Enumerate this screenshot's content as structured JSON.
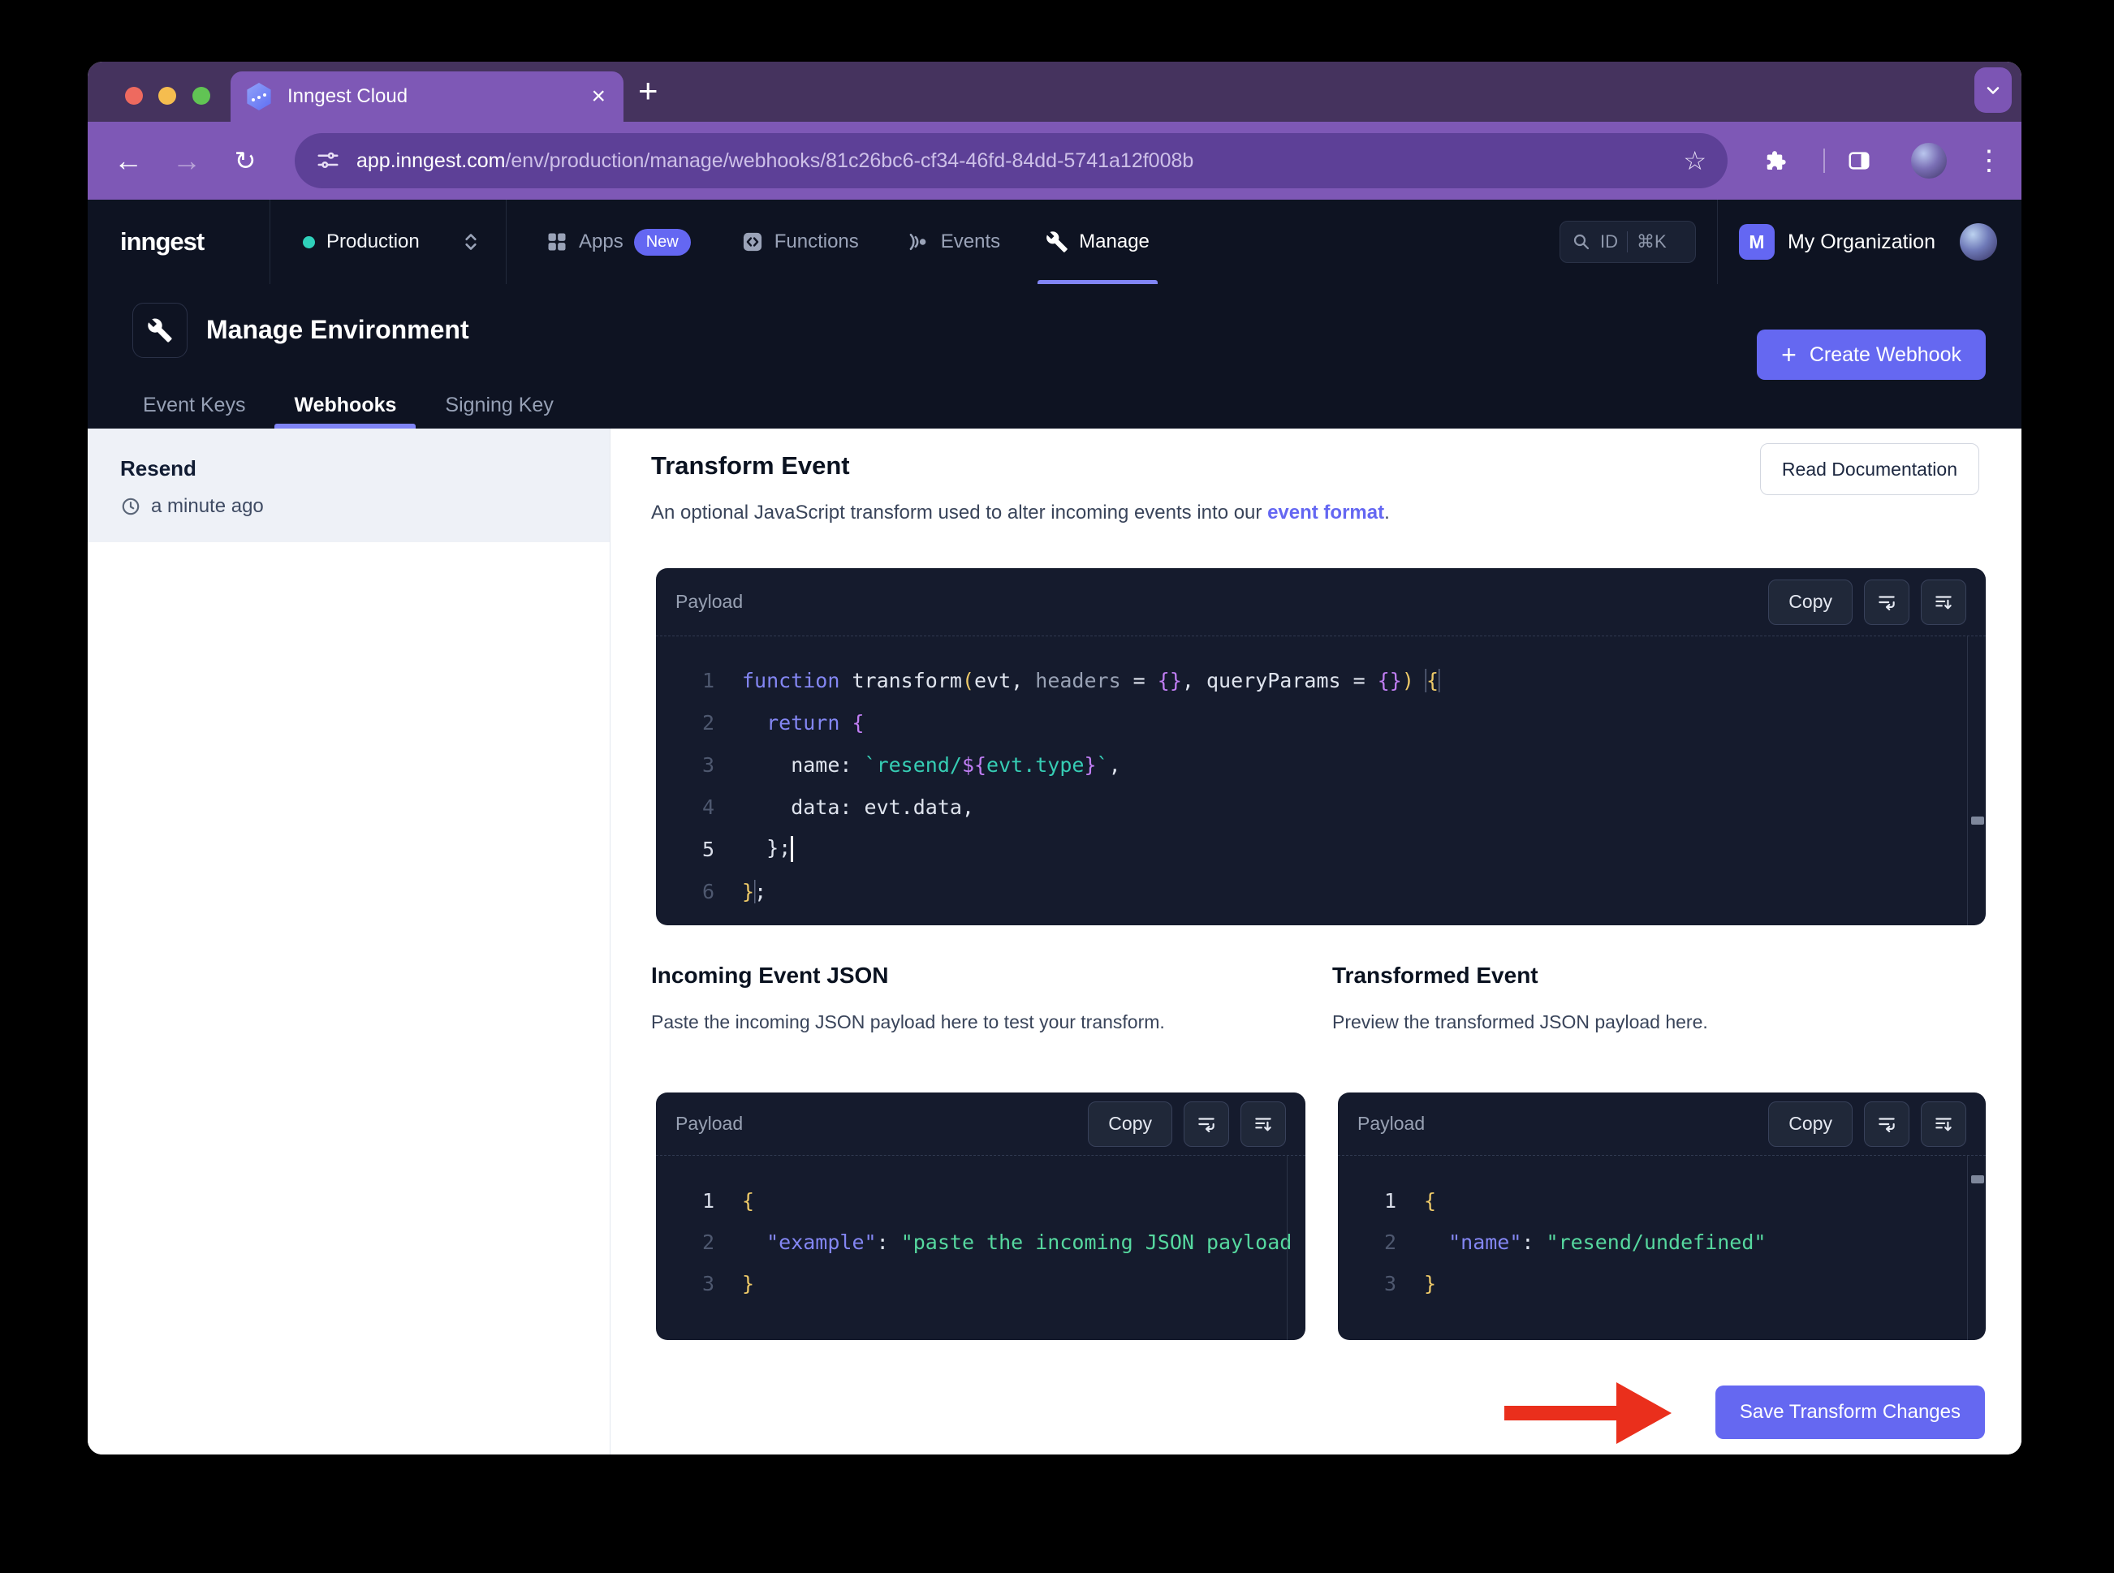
{
  "browser": {
    "tab_title": "Inngest Cloud",
    "url_host": "app.inngest.com",
    "url_path": "/env/production/manage/webhooks/81c26bc6-cf34-46fd-84dd-5741a12f008b",
    "close_glyph": "×",
    "new_tab_glyph": "+",
    "back_glyph": "←",
    "forward_glyph": "→",
    "reload_glyph": "↻",
    "star_glyph": "☆",
    "kebab_glyph": "⋮"
  },
  "nav": {
    "logo": "inngest",
    "env": "Production",
    "apps": "Apps",
    "apps_badge": "New",
    "functions": "Functions",
    "events": "Events",
    "manage": "Manage",
    "search_id": "ID",
    "search_kbd": "⌘K",
    "org_initial": "M",
    "org_name": "My Organization"
  },
  "header": {
    "title": "Manage Environment",
    "create_plus": "+",
    "create": "Create Webhook",
    "tabs": [
      {
        "label": "Event Keys",
        "active": false
      },
      {
        "label": "Webhooks",
        "active": true
      },
      {
        "label": "Signing Key",
        "active": false
      }
    ]
  },
  "sidebar": {
    "name": "Resend",
    "time": "a minute ago"
  },
  "main": {
    "title": "Transform Event",
    "desc_prefix": "An optional JavaScript transform used to alter incoming events into our ",
    "desc_link": "event format",
    "desc_suffix": ".",
    "read_docs": "Read Documentation",
    "payload_label": "Payload",
    "copy_label": "Copy",
    "incoming_title": "Incoming Event JSON",
    "incoming_desc": "Paste the incoming JSON payload here to test your transform.",
    "transformed_title": "Transformed Event",
    "transformed_desc": "Preview the transformed JSON payload here.",
    "save": "Save Transform Changes",
    "transform_lines": [
      {
        "n": "1",
        "active": false,
        "tokens": [
          {
            "c": "k",
            "t": "function"
          },
          {
            "c": "w",
            "t": " transform"
          },
          {
            "c": "y",
            "t": "("
          },
          {
            "c": "w",
            "t": "evt"
          },
          {
            "c": "w",
            "t": ", "
          },
          {
            "c": "g",
            "t": "headers"
          },
          {
            "c": "w",
            "t": " = "
          },
          {
            "c": "p",
            "t": "{}"
          },
          {
            "c": "w",
            "t": ", "
          },
          {
            "c": "w",
            "t": "queryParams"
          },
          {
            "c": "w",
            "t": " = "
          },
          {
            "c": "p",
            "t": "{}"
          },
          {
            "c": "y",
            "t": ")"
          },
          {
            "c": "w",
            "t": " "
          },
          {
            "c": "y",
            "t": "{",
            "box": true
          }
        ]
      },
      {
        "n": "2",
        "active": false,
        "tokens": [
          {
            "c": "k",
            "t": "  return"
          },
          {
            "c": "w",
            "t": " "
          },
          {
            "c": "p",
            "t": "{"
          }
        ]
      },
      {
        "n": "3",
        "active": false,
        "tokens": [
          {
            "c": "w",
            "t": "    name: "
          },
          {
            "c": "t",
            "t": "`resend/"
          },
          {
            "c": "p",
            "t": "${"
          },
          {
            "c": "t",
            "t": "evt.type"
          },
          {
            "c": "p",
            "t": "}"
          },
          {
            "c": "t",
            "t": "`"
          },
          {
            "c": "w",
            "t": ","
          }
        ]
      },
      {
        "n": "4",
        "active": false,
        "tokens": [
          {
            "c": "w",
            "t": "    data: evt.data,"
          }
        ]
      },
      {
        "n": "5",
        "active": true,
        "tokens": [
          {
            "c": "w",
            "t": "  };"
          },
          {
            "caret": true
          }
        ]
      },
      {
        "n": "6",
        "active": false,
        "tokens": [
          {
            "c": "y",
            "t": "}",
            "box": true
          },
          {
            "c": "w",
            "t": ";"
          }
        ]
      }
    ],
    "incoming_lines": [
      {
        "n": "1",
        "active": true,
        "tokens": [
          {
            "c": "y",
            "t": "{"
          }
        ]
      },
      {
        "n": "2",
        "active": false,
        "tokens": [
          {
            "c": "k",
            "t": "  \"example\""
          },
          {
            "c": "w",
            "t": ": "
          },
          {
            "c": "s",
            "t": "\"paste the incoming JSON payload here\""
          }
        ]
      },
      {
        "n": "3",
        "active": false,
        "tokens": [
          {
            "c": "y",
            "t": "}"
          }
        ]
      }
    ],
    "transformed_lines": [
      {
        "n": "1",
        "active": true,
        "tokens": [
          {
            "c": "y",
            "t": "{"
          }
        ]
      },
      {
        "n": "2",
        "active": false,
        "tokens": [
          {
            "c": "k",
            "t": "  \"name\""
          },
          {
            "c": "w",
            "t": ": "
          },
          {
            "c": "s",
            "t": "\"resend/undefined\""
          }
        ]
      },
      {
        "n": "3",
        "active": false,
        "tokens": [
          {
            "c": "y",
            "t": "}"
          }
        ]
      }
    ]
  },
  "colors": {
    "accent_indigo": "#6568f1",
    "chrome_purple": "#7e58b6",
    "chrome_dark_purple": "#45335e",
    "url_pill_purple": "#5d4097",
    "nav_bg": "#0e1322",
    "panel_bg": "#151b2d",
    "env_dot_teal": "#2fd1bb",
    "arrow_red": "#ea2f1c",
    "traffic_red": "#ee6a5f",
    "traffic_yellow": "#f5bd4f",
    "traffic_green": "#61c454"
  }
}
